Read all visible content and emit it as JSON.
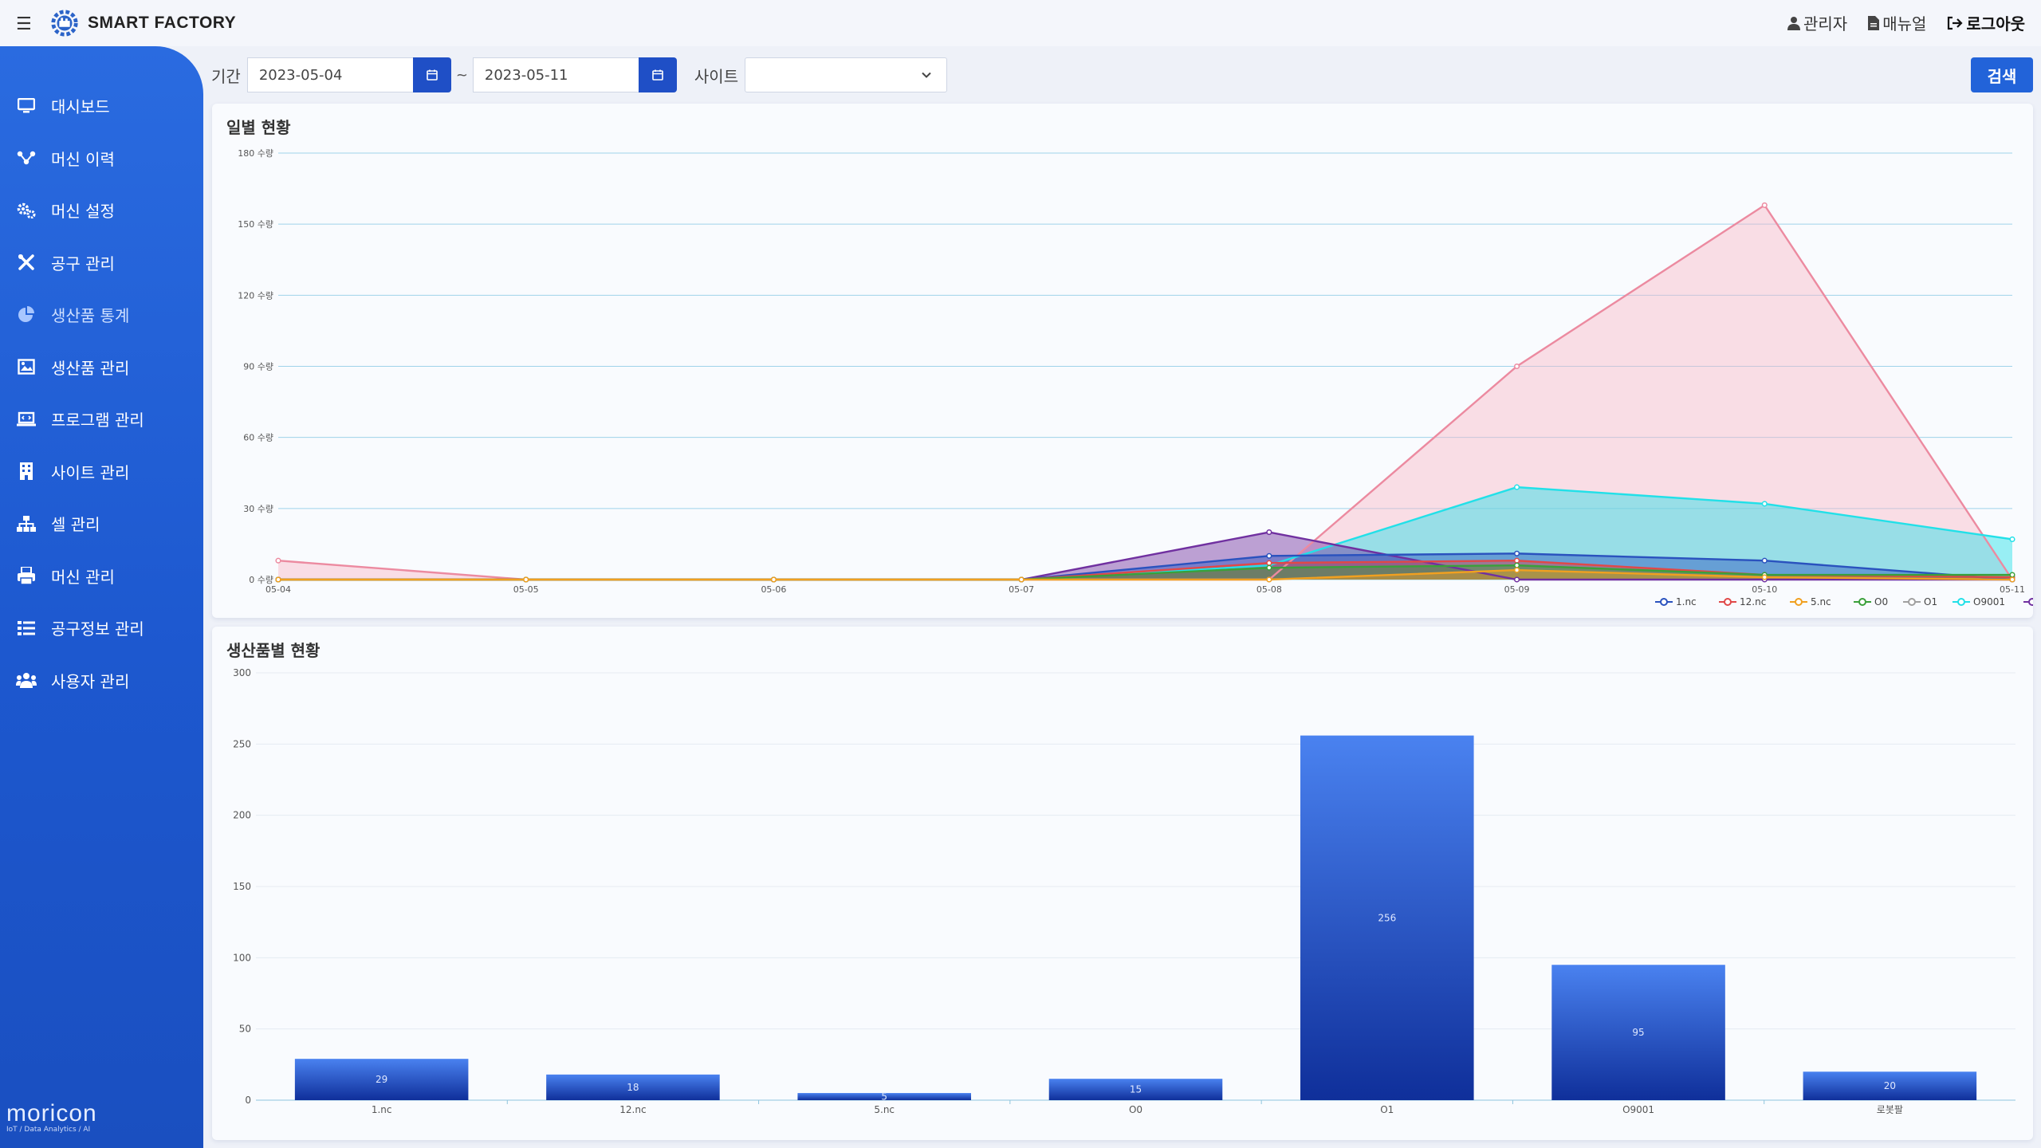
{
  "header": {
    "app_title": "SMART FACTORY",
    "admin_label": "관리자",
    "manual_label": "매뉴얼",
    "logout_label": "로그아웃"
  },
  "sidebar": {
    "items": [
      {
        "label": "대시보드",
        "icon": "monitor-icon"
      },
      {
        "label": "머신 이력",
        "icon": "sitemap-icon"
      },
      {
        "label": "머신 설정",
        "icon": "gears-icon"
      },
      {
        "label": "공구 관리",
        "icon": "tools-icon"
      },
      {
        "label": "생산품 통계",
        "icon": "pie-chart-icon"
      },
      {
        "label": "생산품 관리",
        "icon": "image-icon"
      },
      {
        "label": "프로그램 관리",
        "icon": "laptop-code-icon"
      },
      {
        "label": "사이트 관리",
        "icon": "building-icon"
      },
      {
        "label": "셀 관리",
        "icon": "hierarchy-icon"
      },
      {
        "label": "머신 관리",
        "icon": "printer-icon"
      },
      {
        "label": "공구정보 관리",
        "icon": "list-icon"
      },
      {
        "label": "사용자 관리",
        "icon": "users-icon"
      }
    ],
    "brand_name": "moricon",
    "brand_tagline": "IoT / Data Analytics / AI"
  },
  "filters": {
    "period_label": "기간",
    "start_date": "2023-05-04",
    "separator": "~",
    "end_date": "2023-05-11",
    "site_label": "사이트",
    "site_value": "",
    "search_label": "검색"
  },
  "colors": {
    "accent": "#2263d9",
    "sidebar": "#1d58cf",
    "bar": "#1a45c2"
  },
  "panels": {
    "daily_title": "일별 현황",
    "product_title": "생산품별 현황"
  },
  "chart_data": [
    {
      "type": "area",
      "title": "일별 현황",
      "x": [
        "05-04",
        "05-05",
        "05-06",
        "05-07",
        "05-08",
        "05-09",
        "05-10",
        "05-11"
      ],
      "ylim": [
        0,
        180
      ],
      "yticks": [
        0,
        30,
        60,
        90,
        120,
        150,
        180
      ],
      "ytick_suffix": " 수량",
      "grid": true,
      "legend_position": "bottom-right",
      "series": [
        {
          "name": "1.nc",
          "color": "#2a52be",
          "values": [
            0,
            0,
            0,
            0,
            10,
            11,
            8,
            0
          ]
        },
        {
          "name": "12.nc",
          "color": "#e04848",
          "values": [
            0,
            0,
            0,
            0,
            7,
            8,
            2,
            1
          ]
        },
        {
          "name": "5.nc",
          "color": "#f0a020",
          "values": [
            0,
            0,
            0,
            0,
            0,
            4,
            1,
            0
          ]
        },
        {
          "name": "O0",
          "color": "#3aa03a",
          "values": [
            0,
            0,
            0,
            0,
            5,
            6,
            2,
            2
          ]
        },
        {
          "name": "O1",
          "color": "#a0a0a0",
          "values": [
            8,
            0,
            0,
            0,
            0,
            90,
            158,
            0
          ]
        },
        {
          "name": "O9001",
          "color": "#22e0e8",
          "values": [
            0,
            0,
            0,
            0,
            6,
            39,
            32,
            17
          ]
        },
        {
          "name": "로봇팔",
          "color": "#7030a0",
          "values": [
            0,
            0,
            0,
            0,
            20,
            0,
            0,
            0
          ]
        }
      ]
    },
    {
      "type": "bar",
      "title": "생산품별 현황",
      "categories": [
        "1.nc",
        "12.nc",
        "5.nc",
        "O0",
        "O1",
        "O9001",
        "로봇팔"
      ],
      "values": [
        29,
        18,
        5,
        15,
        256,
        95,
        20
      ],
      "ylim": [
        0,
        300
      ],
      "yticks": [
        0,
        50,
        100,
        150,
        200,
        250,
        300
      ],
      "grid": true
    }
  ]
}
